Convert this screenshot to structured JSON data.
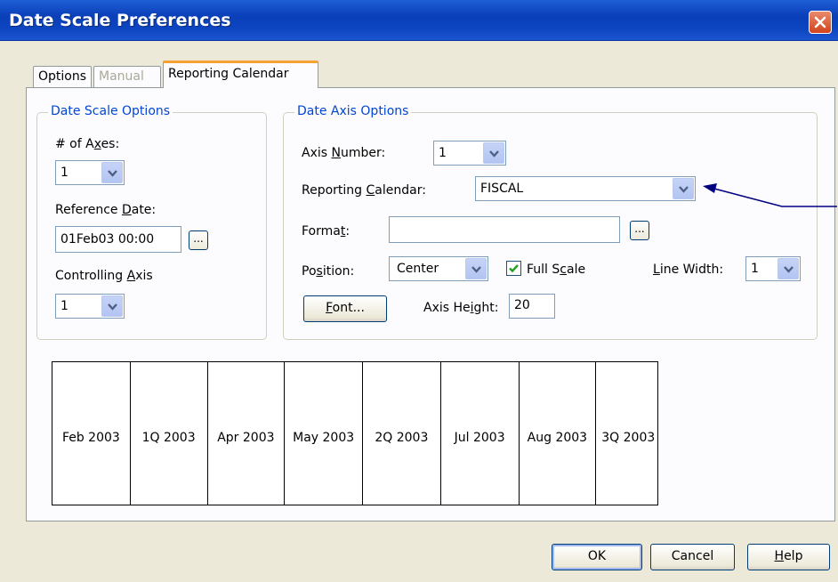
{
  "window": {
    "title": "Date Scale Preferences"
  },
  "tabs": [
    {
      "label": "Options",
      "state": "normal"
    },
    {
      "label": "Manual",
      "state": "disabled"
    },
    {
      "label": "Reporting Calendar",
      "state": "active"
    }
  ],
  "date_scale_options": {
    "legend": "Date Scale Options",
    "num_axes_label_pre": "# of A",
    "num_axes_label_u": "x",
    "num_axes_label_post": "es:",
    "num_axes_value": "1",
    "reference_date_label_pre": "Reference ",
    "reference_date_label_u": "D",
    "reference_date_label_post": "ate:",
    "reference_date_value": "01Feb03 00:00",
    "controlling_axis_label_pre": "Controlling ",
    "controlling_axis_label_u": "A",
    "controlling_axis_label_post": "xis",
    "controlling_axis_value": "1"
  },
  "date_axis_options": {
    "legend": "Date Axis Options",
    "axis_number_label_pre": "Axis ",
    "axis_number_label_u": "N",
    "axis_number_label_post": "umber:",
    "axis_number_value": "1",
    "reporting_calendar_label_pre": "Reporting ",
    "reporting_calendar_label_u": "C",
    "reporting_calendar_label_post": "alendar:",
    "reporting_calendar_value": "FISCAL",
    "format_label_pre": "Forma",
    "format_label_u": "t",
    "format_label_post": ":",
    "format_value": "",
    "position_label_pre": "Po",
    "position_label_u": "s",
    "position_label_post": "ition:",
    "position_value": "Center",
    "full_scale_label_pre": "Full S",
    "full_scale_label_u": "c",
    "full_scale_label_post": "ale",
    "full_scale_checked": true,
    "line_width_label_pre": "",
    "line_width_label_u": "L",
    "line_width_label_post": "ine Width:",
    "line_width_value": "1",
    "font_button_pre": "",
    "font_button_u": "F",
    "font_button_post": "ont...",
    "axis_height_label_pre": "Axis He",
    "axis_height_label_u": "i",
    "axis_height_label_post": "ght:",
    "axis_height_value": "20"
  },
  "preview": {
    "cells": [
      "Feb 2003",
      "1Q 2003",
      "Apr 2003",
      "May 2003",
      "2Q 2003",
      "Jul 2003",
      "Aug 2003",
      "3Q 2003"
    ]
  },
  "footer": {
    "ok_label": "OK",
    "cancel_label": "Cancel",
    "help_label_pre": "",
    "help_label_u": "H",
    "help_label_post": "elp"
  },
  "colors": {
    "title_bar": "#0a3fb8",
    "dialog_bg": "#ece9d8",
    "group_legend": "#0046d5",
    "active_tab_accent": "#f7a234",
    "annotation_arrow": "#000080"
  }
}
